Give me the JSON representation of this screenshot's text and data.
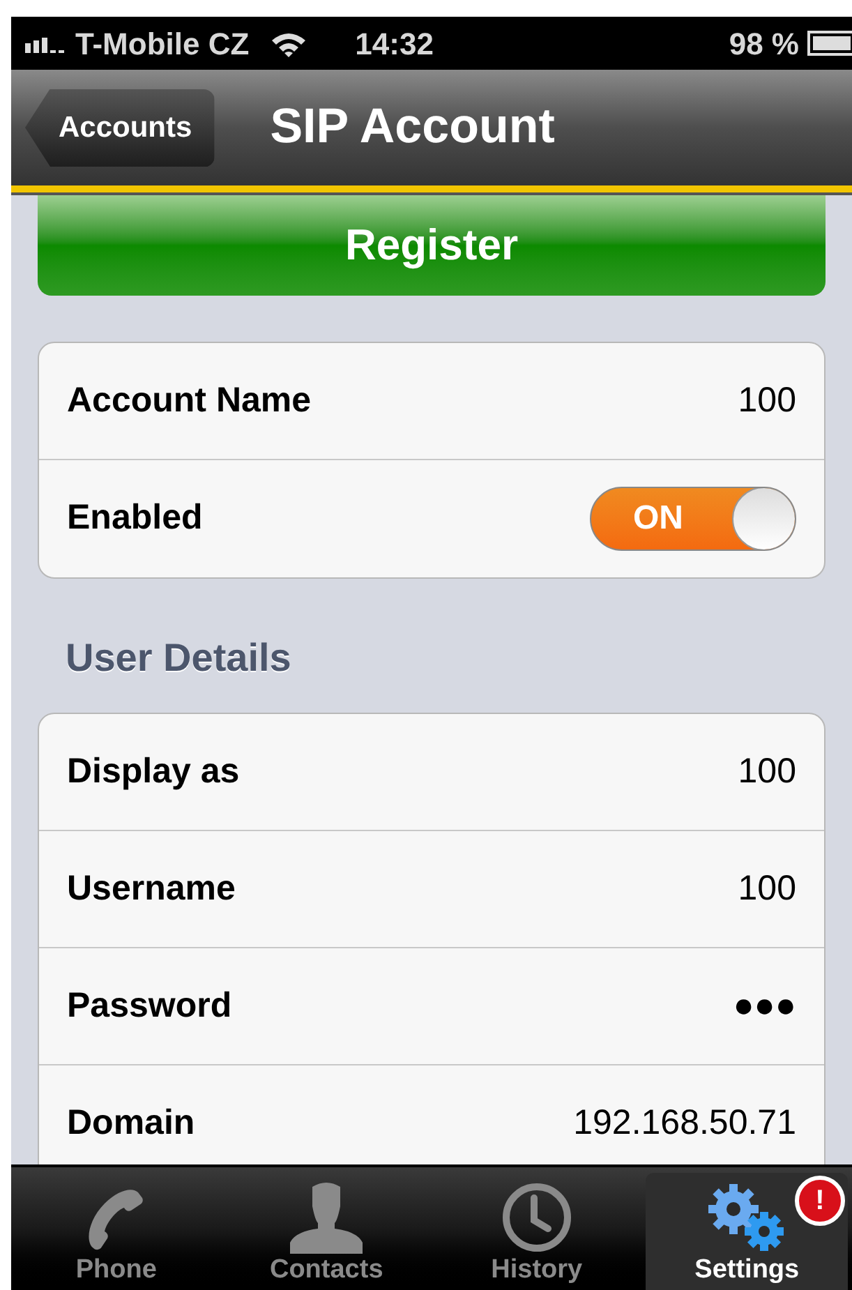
{
  "status_bar": {
    "carrier": "T-Mobile CZ",
    "time": "14:32",
    "battery": "98 %"
  },
  "nav_bar": {
    "back": "Accounts",
    "title": "SIP Account"
  },
  "register_button": "Register",
  "account": [
    {
      "kind": "value",
      "label": "Account Name",
      "value": "100"
    },
    {
      "kind": "toggle",
      "label": "Enabled",
      "value": "ON",
      "on": true
    }
  ],
  "user_details": {
    "header": "User Details",
    "rows": [
      {
        "label": "Display as",
        "value": "100"
      },
      {
        "label": "Username",
        "value": "100"
      },
      {
        "label": "Password",
        "value": "●●●"
      },
      {
        "label": "Domain",
        "value": "192.168.50.71"
      }
    ]
  },
  "tab_bar": [
    {
      "label": "Phone",
      "kind": "phone",
      "selected": false
    },
    {
      "label": "Contacts",
      "kind": "person",
      "selected": false
    },
    {
      "label": "History",
      "kind": "clock",
      "selected": false
    },
    {
      "label": "Settings",
      "kind": "gears",
      "selected": true,
      "badge": "!"
    }
  ]
}
